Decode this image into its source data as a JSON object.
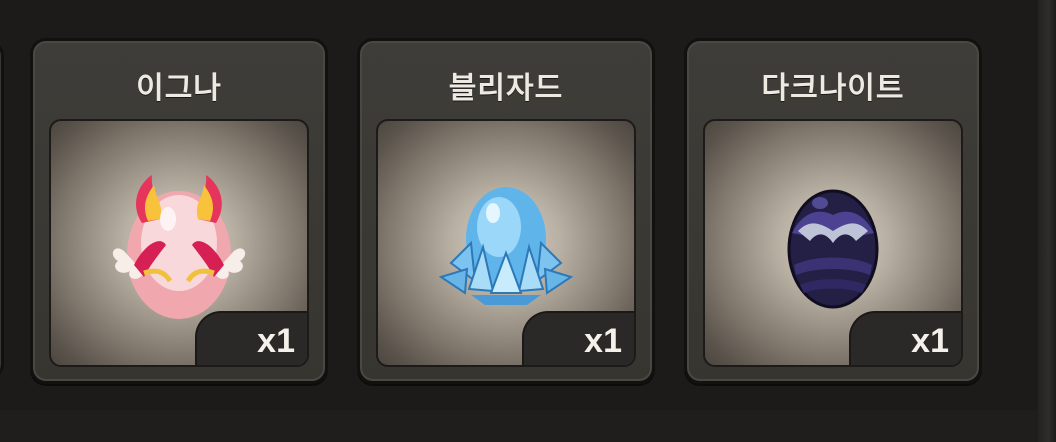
{
  "cards": [
    {
      "title": "이그나",
      "quantity": "x1",
      "icon": "fire-egg-icon"
    },
    {
      "title": "블리자드",
      "quantity": "x1",
      "icon": "ice-egg-icon"
    },
    {
      "title": "다크나이트",
      "quantity": "x1",
      "icon": "dark-egg-icon"
    }
  ]
}
